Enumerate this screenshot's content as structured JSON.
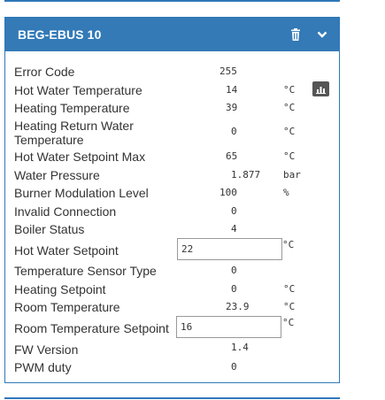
{
  "panel": {
    "title": "BEG-EBUS 10",
    "header_icons": [
      "trash-icon",
      "chevron-down-icon"
    ],
    "chart_icon": "bar-chart-icon",
    "colors": {
      "header_bg": "#337ab7",
      "border": "#2f78b8",
      "chart_btn_bg": "#555555"
    }
  },
  "rows": [
    {
      "label": "Error Code",
      "value": "255",
      "unit": ""
    },
    {
      "label": "Hot Water Temperature",
      "value": "14",
      "unit": "°C"
    },
    {
      "label": "Heating Temperature",
      "value": "39",
      "unit": "°C"
    },
    {
      "label": "Heating Return Water Temperature",
      "value": "0",
      "unit": "°C"
    },
    {
      "label": "Hot Water Setpoint Max",
      "value": "65",
      "unit": "°C"
    },
    {
      "label": "Water Pressure",
      "value": "1.877",
      "unit": "bar"
    },
    {
      "label": "Burner Modulation Level",
      "value": "100",
      "unit": "%"
    },
    {
      "label": "Invalid Connection",
      "value": "0",
      "unit": ""
    },
    {
      "label": "Boiler Status",
      "value": "4",
      "unit": ""
    },
    {
      "label": "Hot Water Setpoint",
      "input_value": "22",
      "unit": "°C"
    },
    {
      "label": "Temperature Sensor Type",
      "value": "0",
      "unit": ""
    },
    {
      "label": "Heating Setpoint",
      "value": "0",
      "unit": "°C"
    },
    {
      "label": "Room Temperature",
      "value": "23.9",
      "unit": "°C"
    },
    {
      "label": "Room Temperature Setpoint",
      "input_value": "16",
      "unit": "°C"
    },
    {
      "label": "FW Version",
      "value": "1.4",
      "unit": ""
    },
    {
      "label": "PWM duty",
      "value": "0",
      "unit": ""
    }
  ]
}
